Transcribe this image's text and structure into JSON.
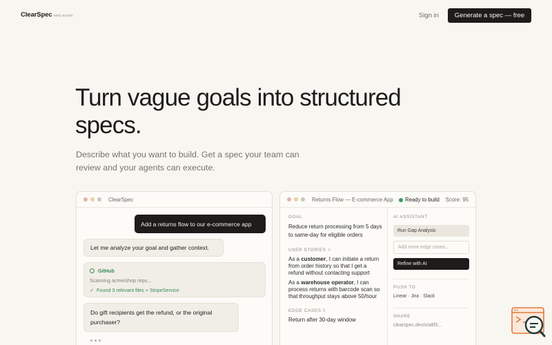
{
  "nav": {
    "brand": "ClearSpec",
    "brand_tag": "early access",
    "signin": "Sign in",
    "cta": "Generate a spec — free"
  },
  "hero": {
    "title": "Turn vague goals into structured specs.",
    "subtitle": "Describe what you want to build. Get a spec your team can review and your agents can execute."
  },
  "chat_panel": {
    "title": "ClearSpec",
    "user_message": "Add a returns flow to our e-commerce app",
    "ai_message": "Let me analyze your goal and gather context.",
    "tool": {
      "name": "GitHub",
      "status": "Scanning acme/shop repo...",
      "result_icon": "✓",
      "result": "Found 3 relevant files + StripeService"
    },
    "question": "Do gift recipients get the refund, or the original purchaser?"
  },
  "spec_panel": {
    "title": "Returns Flow — E-commerce App",
    "status": "Ready to build",
    "score": "Score: 95",
    "goal_label": "GOAL",
    "goal": "Reduce return processing from 5 days to same-day for eligible orders",
    "stories_label": "USER STORIES",
    "stories_count": "3",
    "stories": [
      {
        "prefix": "As a ",
        "role": "customer",
        "text": ", I can initiate a return from order history so that I get a refund without contacting support"
      },
      {
        "prefix": "As a ",
        "role": "warehouse operator",
        "text": ", I can process returns with barcode scan so that throughput stays above 50/hour"
      }
    ],
    "edge_label": "EDGE CASES",
    "edge_count": "5",
    "edge_first": "Return after 30-day window",
    "assistant": {
      "label": "AI ASSISTANT",
      "gap_button": "Run Gap Analysis",
      "input_placeholder": "Add more edge cases...",
      "refine_button": "Refine with AI"
    },
    "push": {
      "label": "PUSH TO",
      "targets": "Linear · Jira · Slack"
    },
    "share": {
      "label": "SHARE",
      "url": "clearspec.dev/s/a8f3..."
    }
  },
  "colors": {
    "background": "#f8f6f1",
    "accent_dark": "#1d1c1a",
    "success": "#3a9a5b",
    "widget": "#e07a3c"
  }
}
